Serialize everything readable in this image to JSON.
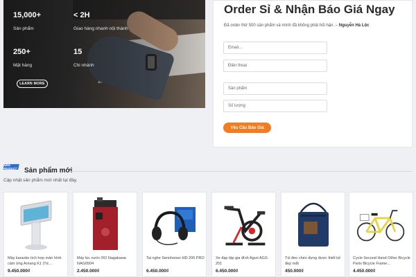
{
  "hero": {
    "stats": [
      {
        "value": "15,000+",
        "label": "Sản phẩm"
      },
      {
        "value": "< 2H",
        "label": "Giao hàng nhanh nội thành"
      },
      {
        "value": "250+",
        "label": "Mặt hàng"
      },
      {
        "value": "15",
        "label": "Chi nhánh"
      }
    ],
    "learn_more": "LEARN MORE"
  },
  "form": {
    "title": "Order Sỉ & Nhận Báo Giá Ngay",
    "subtitle": "Đã order thử 500 sản phẩm và mình đã không phải hối hận.",
    "subtitle_dash": " – ",
    "subtitle_author": "Nguyễn Hà Lộc",
    "fields": [
      {
        "placeholder": "Email..."
      },
      {
        "placeholder": "Điện thoại"
      },
      {
        "placeholder": "Sản phẩm"
      },
      {
        "placeholder": "Số lượng"
      }
    ],
    "submit": "Yêu Cầu Báo Giá"
  },
  "section": {
    "badge": "NEW PRODUCT",
    "title": "Sản phẩm mới",
    "subtitle": "Cập nhật sản phẩm mới nhất tại đây."
  },
  "products": [
    {
      "name": "Máy karaoke tích hợp màn hình cảm ứng Arirang K1 (Tic...",
      "price": "9.450.000₫",
      "icon": "karaoke-kiosk-icon"
    },
    {
      "name": "Máy lọc nước RO Nagakawa NAG0504",
      "price": "2.450.000₫",
      "icon": "water-purifier-icon"
    },
    {
      "name": "Tai nghe Sennheiser HD 200 PRO",
      "price": "6.450.000₫",
      "icon": "headphones-icon"
    },
    {
      "name": "Xe đạp tập gia đình Aguri AGS-201",
      "price": "6.450.000₫",
      "icon": "exercise-bike-icon"
    },
    {
      "name": "Túi đeo chéo đựng được thiết kế đẹp mắt",
      "price": "450.000₫",
      "icon": "shoulder-bag-icon"
    },
    {
      "name": "Cycle Second Hand Other Bicycle Parts Bicycle Frame...",
      "price": "4.450.000₫",
      "icon": "bicycle-icon"
    }
  ],
  "colors": {
    "accent": "#f47b20",
    "badge": "#2f6fd0"
  }
}
